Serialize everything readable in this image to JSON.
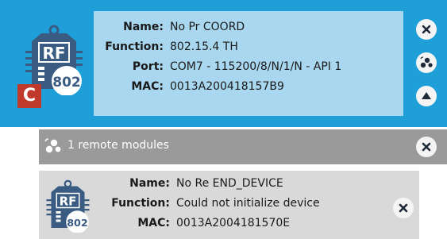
{
  "local_module": {
    "fields": [
      {
        "key": "Name:",
        "value": "No Pr COORD"
      },
      {
        "key": "Function:",
        "value": "802.15.4 TH"
      },
      {
        "key": "Port:",
        "value": "COM7 - 115200/8/N/1/N - API 1"
      },
      {
        "key": "MAC:",
        "value": "0013A200418157B9"
      }
    ],
    "icon": {
      "top_text": "RF",
      "protocol_text": "802",
      "badge": "C",
      "name": "xbee-radio-icon"
    },
    "buttons": [
      "close-icon",
      "discover-remote-icon",
      "collapse-up-icon"
    ]
  },
  "remote_header": {
    "label": "1 remote modules",
    "icon": "remote-modules-icon",
    "button": "close-icon"
  },
  "remote_module": {
    "fields": [
      {
        "key": "Name:",
        "value": "No Re END_DEVICE"
      },
      {
        "key": "Function:",
        "value": "Could not initialize device"
      },
      {
        "key": "MAC:",
        "value": "0013A2004181570E"
      }
    ],
    "icon": {
      "top_text": "RF",
      "protocol_text": "802",
      "name": "xbee-radio-icon"
    },
    "button": "close-icon"
  },
  "colors": {
    "local_bg": "#1e9fd8",
    "local_info_bg": "#a9d7ef",
    "remote_header_bg": "#9a9a9a",
    "remote_card_bg": "#d9d9d9",
    "badge_red": "#c0392b"
  }
}
